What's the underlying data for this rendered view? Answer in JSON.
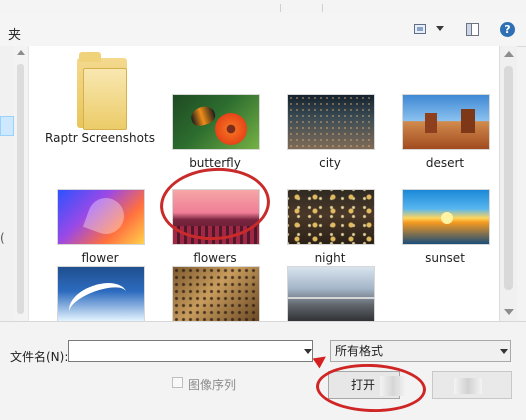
{
  "toolbar": {
    "left_char": "夹",
    "help_label": "?"
  },
  "nav": {
    "left_text": "("
  },
  "files": [
    {
      "name": "Raptr Screenshots",
      "type": "folder"
    },
    {
      "name": "butterfly",
      "type": "image"
    },
    {
      "name": "city",
      "type": "image"
    },
    {
      "name": "desert",
      "type": "image"
    },
    {
      "name": "flower",
      "type": "image"
    },
    {
      "name": "flowers",
      "type": "image",
      "highlighted": true
    },
    {
      "name": "night",
      "type": "image"
    },
    {
      "name": "sunset",
      "type": "image"
    },
    {
      "name": "",
      "type": "image"
    },
    {
      "name": "",
      "type": "image"
    },
    {
      "name": "",
      "type": "image"
    }
  ],
  "footer": {
    "filename_label": "文件名(N):",
    "filename_value": "",
    "filetype_value": "所有格式",
    "checkbox_label": "图像序列",
    "open_button_label": "打开"
  },
  "colors": {
    "highlight_red": "#c92a2a",
    "window_bg": "#f3f3f3",
    "content_bg": "#ffffff"
  }
}
